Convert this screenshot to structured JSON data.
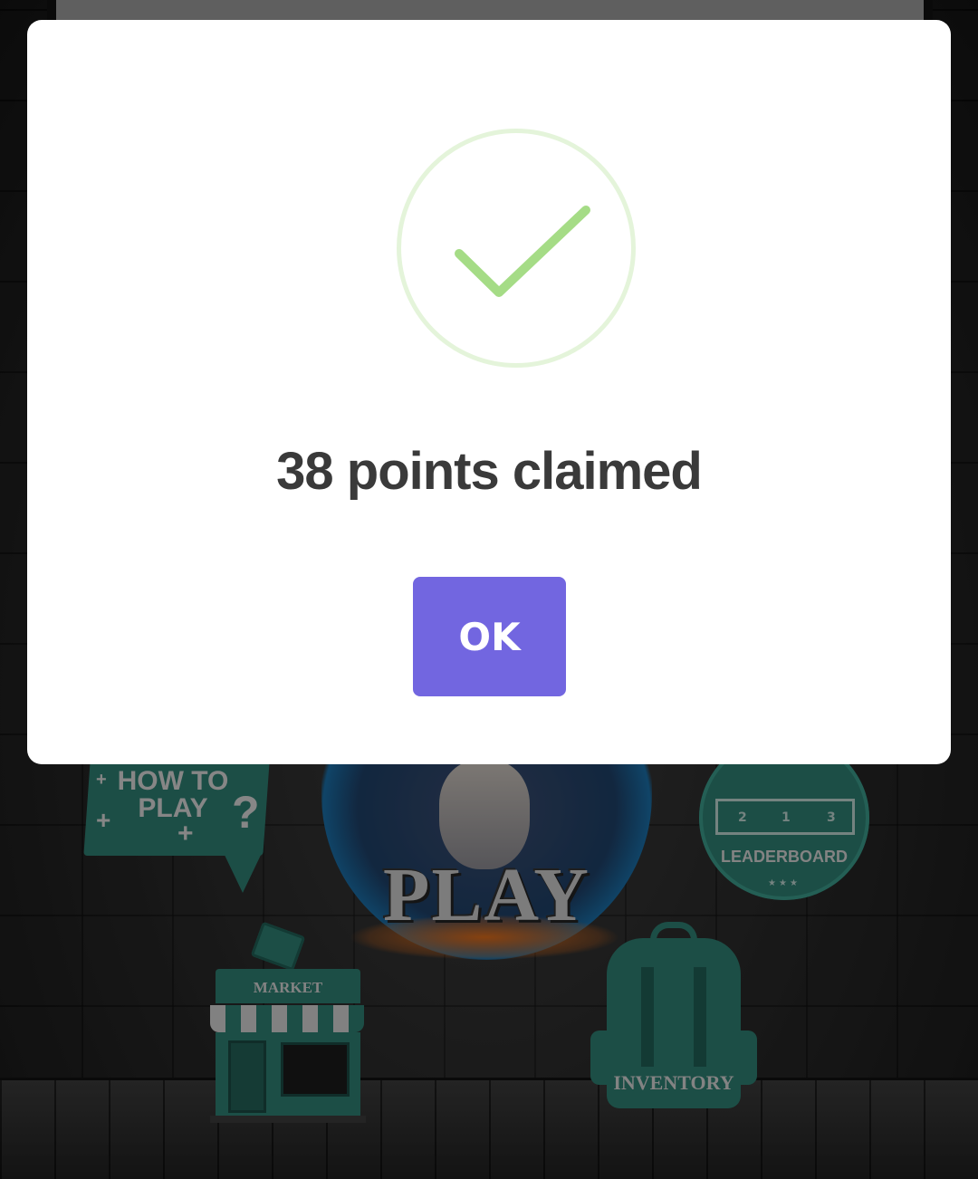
{
  "game_menu": {
    "how_to_play_label": "HOW TO PLAY",
    "how_to_play_symbol": "?",
    "play_label": "PLAY",
    "leaderboard_label": "LEADERBOARD",
    "leaderboard_ranks": [
      "2",
      "1",
      "3"
    ],
    "market_label": "MARKET",
    "inventory_label": "INVENTORY"
  },
  "modal": {
    "icon": "success-check-icon",
    "message": "38 points claimed",
    "ok_label": "OK",
    "colors": {
      "check": "#a5dc86",
      "button": "#7266e0",
      "text": "#3a3a3a"
    }
  }
}
